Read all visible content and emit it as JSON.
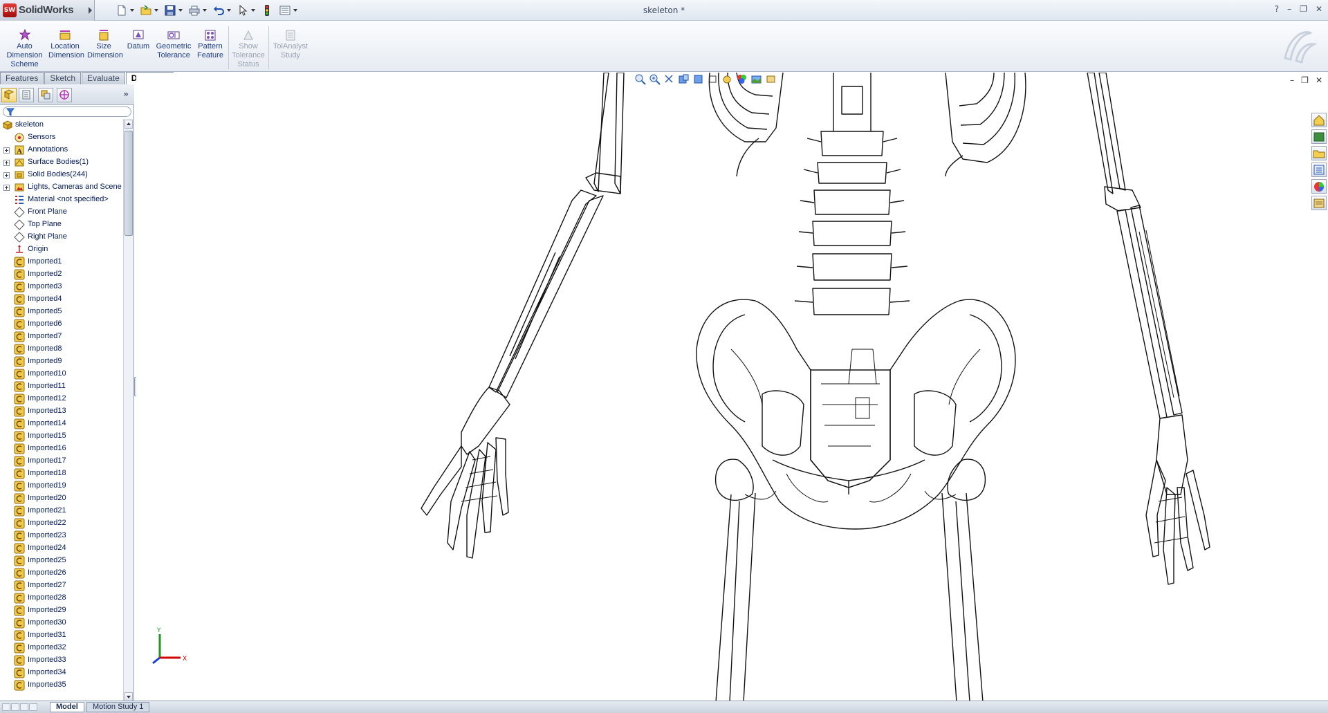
{
  "app": {
    "name": "SolidWorks",
    "badge": "SW",
    "document_title": "skeleton *"
  },
  "quick_access": [
    {
      "name": "new",
      "icon": "new-document-icon"
    },
    {
      "name": "open",
      "icon": "open-folder-icon"
    },
    {
      "name": "save",
      "icon": "save-disk-icon"
    },
    {
      "name": "print",
      "icon": "print-icon"
    },
    {
      "name": "undo",
      "icon": "undo-arrow-icon"
    },
    {
      "name": "select",
      "icon": "select-pointer-icon"
    },
    {
      "name": "rebuild",
      "icon": "traffic-light-icon"
    },
    {
      "name": "options",
      "icon": "options-icon"
    }
  ],
  "window_controls": {
    "help": "?",
    "minimize": "–",
    "restore": "❐",
    "close": "✕"
  },
  "command_manager": [
    {
      "label": "Auto\nDimension\nScheme",
      "enabled": true,
      "icon": "auto-dimension-icon"
    },
    {
      "label": "Location\nDimension",
      "enabled": true,
      "icon": "location-dimension-icon"
    },
    {
      "label": "Size\nDimension",
      "enabled": true,
      "icon": "size-dimension-icon"
    },
    {
      "label": "Datum",
      "enabled": true,
      "icon": "datum-icon"
    },
    {
      "label": "Geometric\nTolerance",
      "enabled": true,
      "icon": "geometric-tolerance-icon"
    },
    {
      "label": "Pattern\nFeature",
      "enabled": true,
      "icon": "pattern-feature-icon"
    },
    {
      "label": "Show\nTolerance\nStatus",
      "enabled": false,
      "icon": "tolerance-status-icon"
    },
    {
      "label": "TolAnalyst\nStudy",
      "enabled": false,
      "icon": "tolanalyst-icon"
    }
  ],
  "tabs": [
    "Features",
    "Sketch",
    "Evaluate",
    "DimXpert"
  ],
  "active_tab": "DimXpert",
  "feature_tree": {
    "root": "skeleton",
    "items": [
      {
        "label": "Sensors",
        "icon": "sensors-icon",
        "expandable": false
      },
      {
        "label": "Annotations",
        "icon": "annotations-icon",
        "expandable": true
      },
      {
        "label": "Surface Bodies(1)",
        "icon": "surface-bodies-icon",
        "expandable": true
      },
      {
        "label": "Solid Bodies(244)",
        "icon": "solid-bodies-icon",
        "expandable": true
      },
      {
        "label": "Lights, Cameras and Scene",
        "icon": "lights-cameras-icon",
        "expandable": true
      },
      {
        "label": "Material <not specified>",
        "icon": "material-icon",
        "expandable": false
      },
      {
        "label": "Front Plane",
        "icon": "plane-icon",
        "expandable": false
      },
      {
        "label": "Top Plane",
        "icon": "plane-icon",
        "expandable": false
      },
      {
        "label": "Right Plane",
        "icon": "plane-icon",
        "expandable": false
      },
      {
        "label": "Origin",
        "icon": "origin-icon",
        "expandable": false
      },
      {
        "label": "Imported1",
        "icon": "imported-feature-icon",
        "expandable": false
      },
      {
        "label": "Imported2",
        "icon": "imported-feature-icon",
        "expandable": false
      },
      {
        "label": "Imported3",
        "icon": "imported-feature-icon",
        "expandable": false
      },
      {
        "label": "Imported4",
        "icon": "imported-feature-icon",
        "expandable": false
      },
      {
        "label": "Imported5",
        "icon": "imported-feature-icon",
        "expandable": false
      },
      {
        "label": "Imported6",
        "icon": "imported-feature-icon",
        "expandable": false
      },
      {
        "label": "Imported7",
        "icon": "imported-feature-icon",
        "expandable": false
      },
      {
        "label": "Imported8",
        "icon": "imported-feature-icon",
        "expandable": false
      },
      {
        "label": "Imported9",
        "icon": "imported-feature-icon",
        "expandable": false
      },
      {
        "label": "Imported10",
        "icon": "imported-feature-icon",
        "expandable": false
      },
      {
        "label": "Imported11",
        "icon": "imported-feature-icon",
        "expandable": false
      },
      {
        "label": "Imported12",
        "icon": "imported-feature-icon",
        "expandable": false
      },
      {
        "label": "Imported13",
        "icon": "imported-feature-icon",
        "expandable": false
      },
      {
        "label": "Imported14",
        "icon": "imported-feature-icon",
        "expandable": false
      },
      {
        "label": "Imported15",
        "icon": "imported-feature-icon",
        "expandable": false
      },
      {
        "label": "Imported16",
        "icon": "imported-feature-icon",
        "expandable": false
      },
      {
        "label": "Imported17",
        "icon": "imported-feature-icon",
        "expandable": false
      },
      {
        "label": "Imported18",
        "icon": "imported-feature-icon",
        "expandable": false
      },
      {
        "label": "Imported19",
        "icon": "imported-feature-icon",
        "expandable": false
      },
      {
        "label": "Imported20",
        "icon": "imported-feature-icon",
        "expandable": false
      },
      {
        "label": "Imported21",
        "icon": "imported-feature-icon",
        "expandable": false
      },
      {
        "label": "Imported22",
        "icon": "imported-feature-icon",
        "expandable": false
      },
      {
        "label": "Imported23",
        "icon": "imported-feature-icon",
        "expandable": false
      },
      {
        "label": "Imported24",
        "icon": "imported-feature-icon",
        "expandable": false
      },
      {
        "label": "Imported25",
        "icon": "imported-feature-icon",
        "expandable": false
      },
      {
        "label": "Imported26",
        "icon": "imported-feature-icon",
        "expandable": false
      },
      {
        "label": "Imported27",
        "icon": "imported-feature-icon",
        "expandable": false
      },
      {
        "label": "Imported28",
        "icon": "imported-feature-icon",
        "expandable": false
      },
      {
        "label": "Imported29",
        "icon": "imported-feature-icon",
        "expandable": false
      },
      {
        "label": "Imported30",
        "icon": "imported-feature-icon",
        "expandable": false
      },
      {
        "label": "Imported31",
        "icon": "imported-feature-icon",
        "expandable": false
      },
      {
        "label": "Imported32",
        "icon": "imported-feature-icon",
        "expandable": false
      },
      {
        "label": "Imported33",
        "icon": "imported-feature-icon",
        "expandable": false
      },
      {
        "label": "Imported34",
        "icon": "imported-feature-icon",
        "expandable": false
      },
      {
        "label": "Imported35",
        "icon": "imported-feature-icon",
        "expandable": false
      }
    ]
  },
  "triad": {
    "x": "X",
    "y": "Y",
    "colors": {
      "x": "#d40000",
      "y": "#1d9a1d",
      "z": "#1c3fd4"
    }
  },
  "bottom_tabs": [
    "Model",
    "Motion Study 1"
  ],
  "active_bottom_tab": "Model",
  "colors": {
    "accent": "#1e3d80",
    "panel": "#e6ebf2",
    "model_lines": "#111111"
  }
}
